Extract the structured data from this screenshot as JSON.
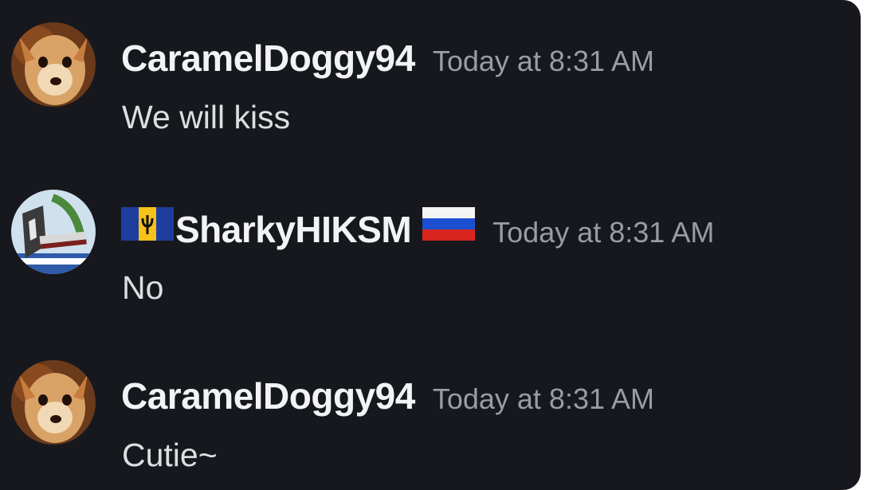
{
  "messages": [
    {
      "username": "CaramelDoggy94",
      "timestamp": "Today at 8:31 AM",
      "content": "We will kiss",
      "avatar_icon": "dog-avatar-icon"
    },
    {
      "username": "SharkyHIKSM",
      "timestamp": "Today at 8:31 AM",
      "content": "No",
      "avatar_icon": "drawing-avatar-icon",
      "flag_before": "barbados-flag-icon",
      "flag_after": "russia-flag-icon"
    },
    {
      "username": "CaramelDoggy94",
      "timestamp": "Today at 8:31 AM",
      "content": "Cutie~",
      "avatar_icon": "dog-avatar-icon"
    }
  ],
  "colors": {
    "background": "#17181d",
    "username": "#f2f3f5",
    "timestamp": "#9a9ca3",
    "message_text": "#dcdee2"
  }
}
